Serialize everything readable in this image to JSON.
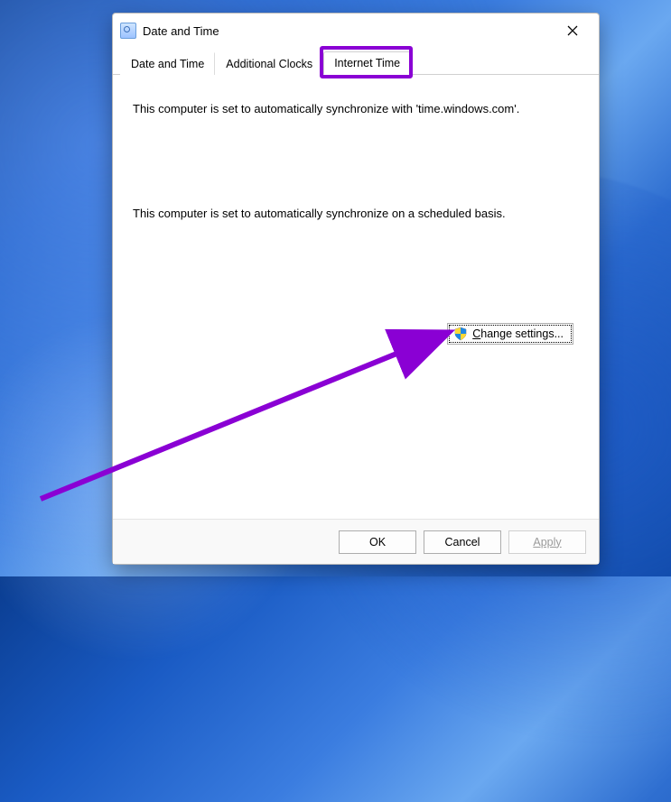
{
  "window": {
    "title": "Date and Time"
  },
  "tabs": {
    "date_time": "Date and Time",
    "additional_clocks": "Additional Clocks",
    "internet_time": "Internet Time"
  },
  "content": {
    "sync_msg": "This computer is set to automatically synchronize with 'time.windows.com'.",
    "schedule_msg": "This computer is set to automatically synchronize on a scheduled basis.",
    "change_settings": "Change settings..."
  },
  "buttons": {
    "ok": "OK",
    "cancel": "Cancel",
    "apply": "Apply"
  },
  "annotations": {
    "highlight_tab": "internet_time",
    "arrow_target": "change-settings-button"
  }
}
